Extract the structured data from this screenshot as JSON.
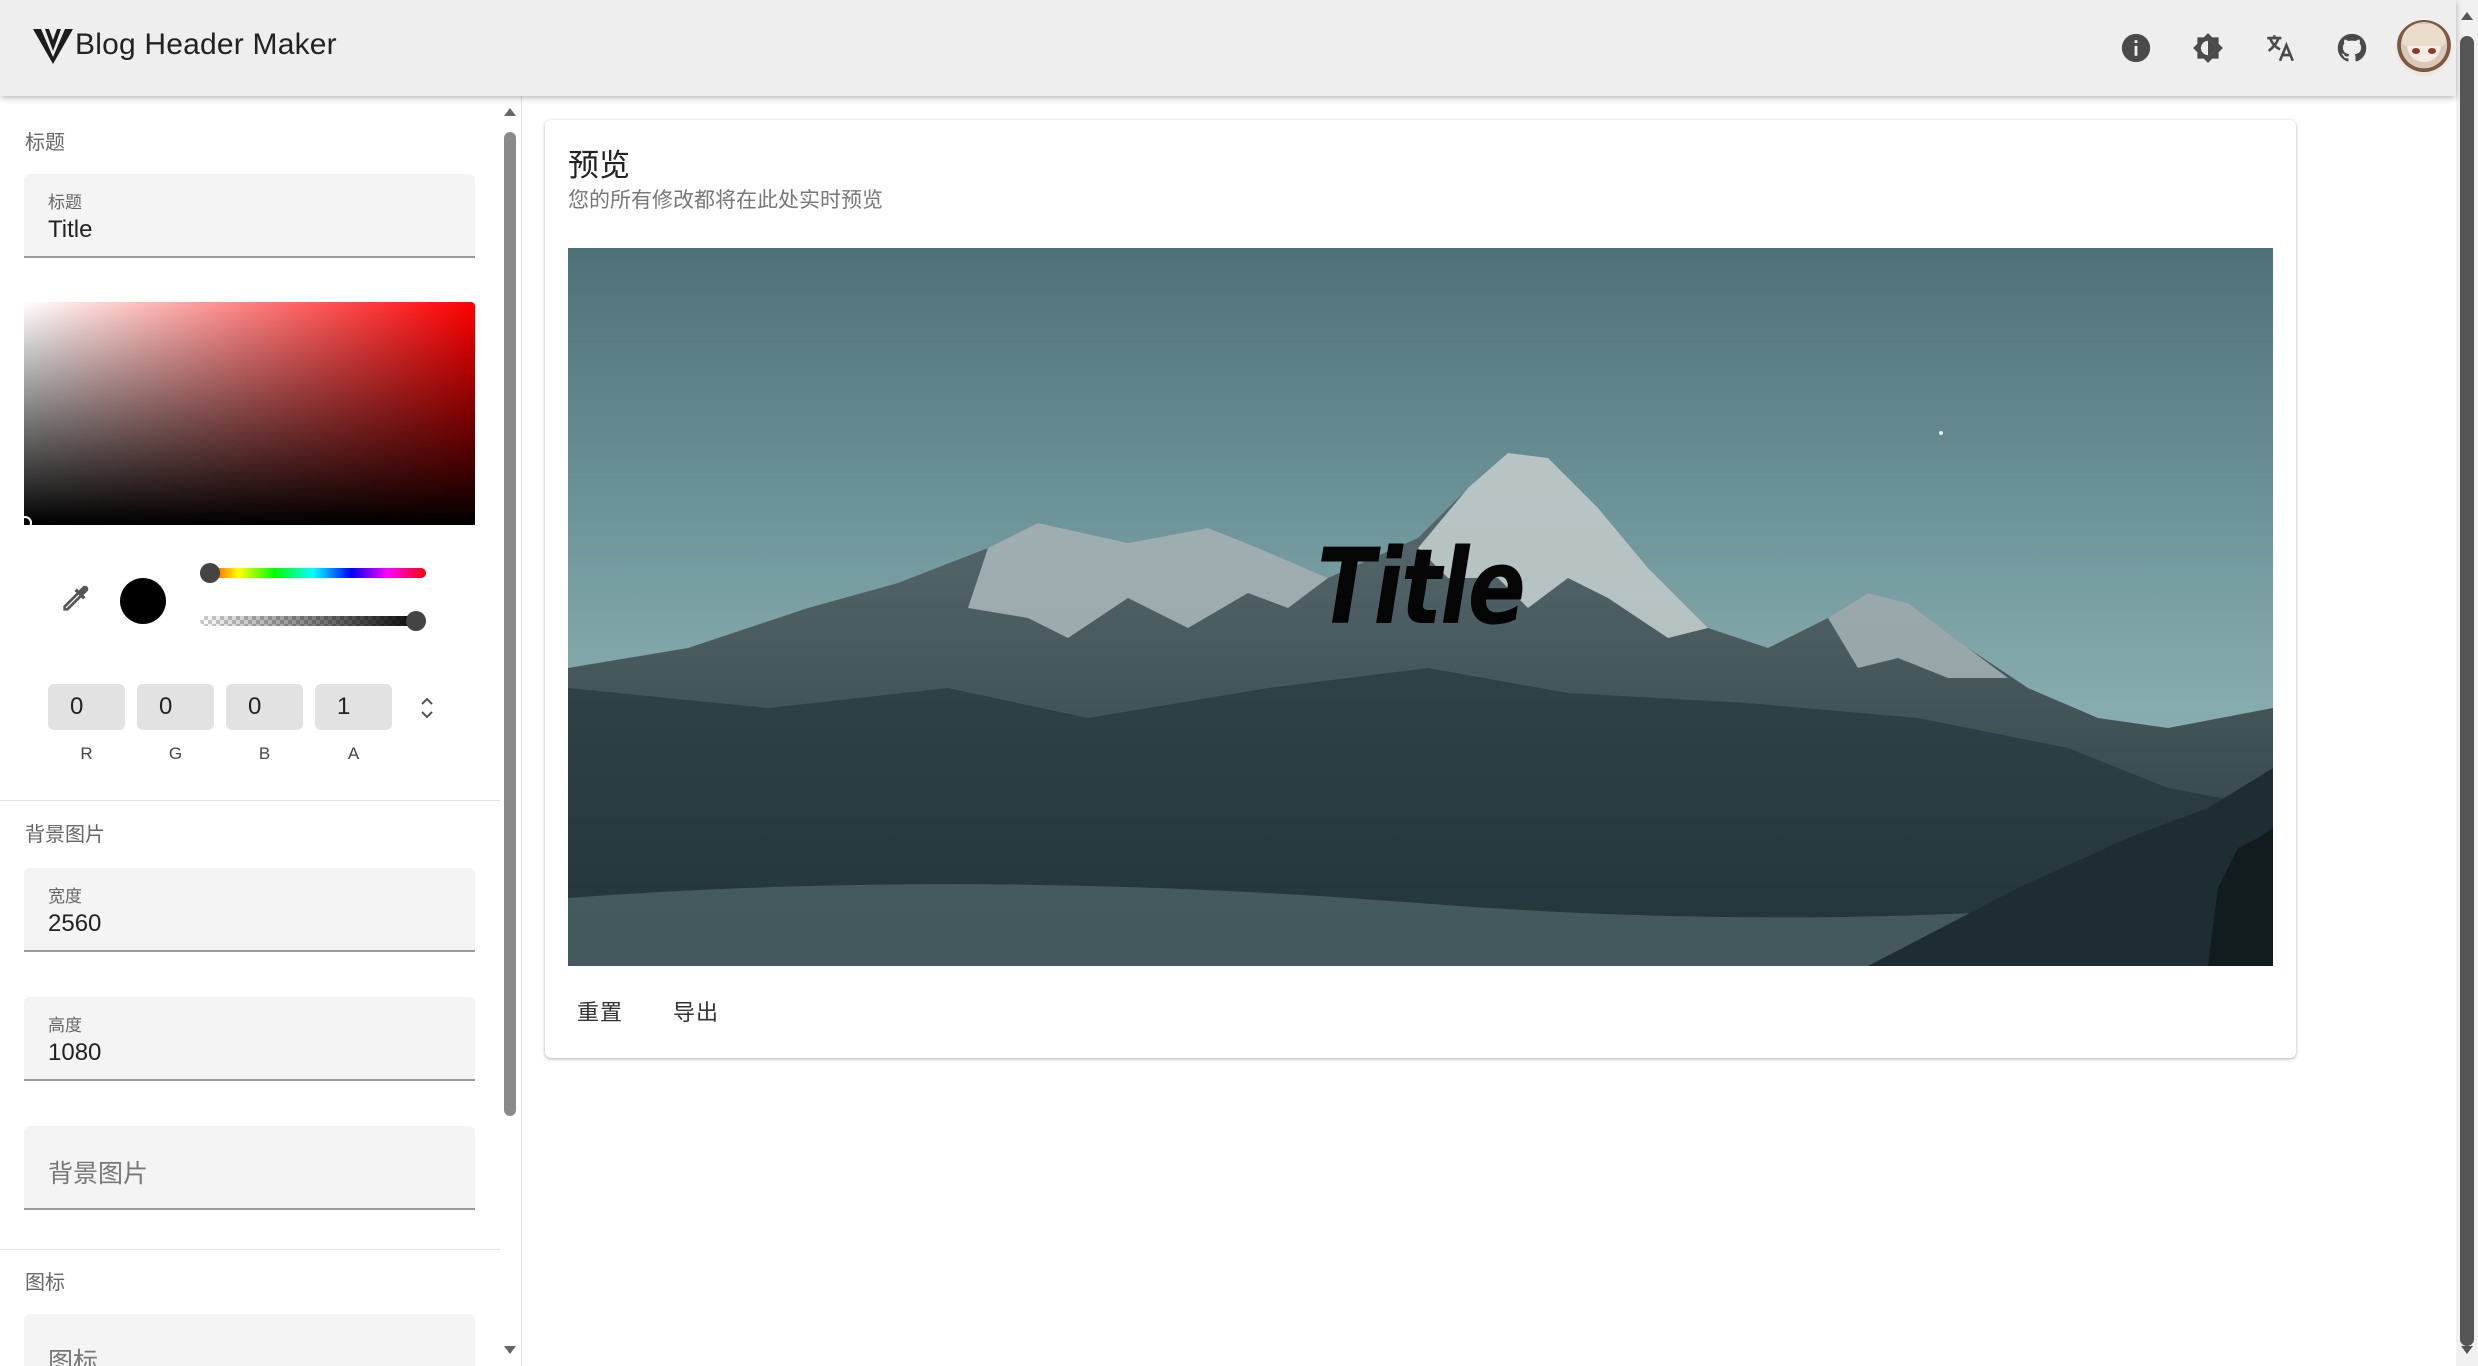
{
  "header": {
    "app_title": "Blog Header Maker",
    "actions": [
      {
        "icon": "info-icon"
      },
      {
        "icon": "brightness-icon"
      },
      {
        "icon": "translate-icon"
      },
      {
        "icon": "github-icon"
      }
    ],
    "avatar_icon": "avatar-icon"
  },
  "sidebar": {
    "title_section": {
      "label": "标题",
      "field_label": "标题",
      "field_value": "Title"
    },
    "color_picker": {
      "hue": 0,
      "alpha": 1,
      "selected_color": "#000000",
      "r": "0",
      "g": "0",
      "b": "0",
      "a": "1",
      "r_label": "R",
      "g_label": "G",
      "b_label": "B",
      "a_label": "A"
    },
    "background_section": {
      "label": "背景图片",
      "width_label": "宽度",
      "width_value": "2560",
      "height_label": "高度",
      "height_value": "1080",
      "image_placeholder": "背景图片"
    },
    "icon_section": {
      "label": "图标",
      "icon_placeholder": "图标"
    }
  },
  "main": {
    "card_title": "预览",
    "card_subtitle": "您的所有修改都将在此处实时预览",
    "preview_title": "Title",
    "reset_button": "重置",
    "export_button": "导出"
  },
  "colors": {
    "appbar_bg": "#eeeeee",
    "field_bg": "#f4f4f4",
    "title_color": "#000000"
  }
}
